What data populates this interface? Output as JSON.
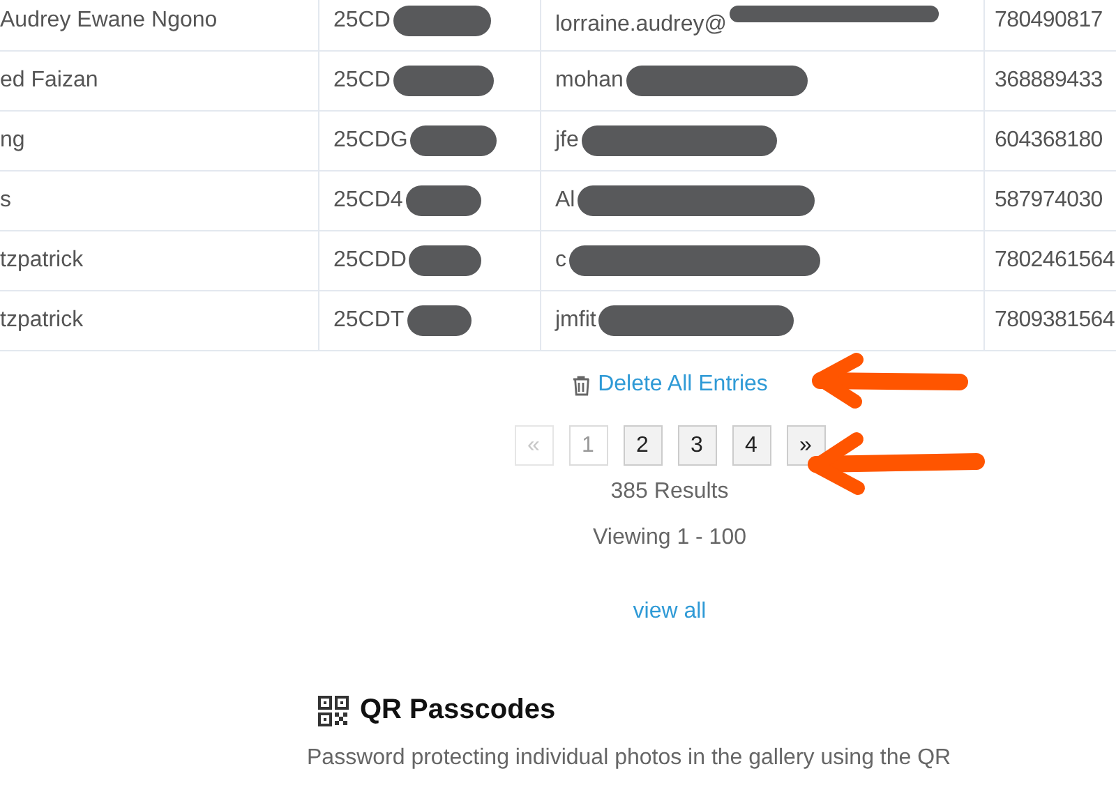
{
  "table": {
    "rows": [
      {
        "column_1": "Audrey Ewane Ngono",
        "column_2": "25CD",
        "column_3": "lorraine.audrey@",
        "column_4": "780490817"
      },
      {
        "column_1": "ed Faizan",
        "column_2": "25CD",
        "column_3": "mohan",
        "column_4": "368889433"
      },
      {
        "column_1": "ng",
        "column_2": "25CDG",
        "column_3": "jfe",
        "column_4": "604368180"
      },
      {
        "column_1": "s",
        "column_2": "25CD4",
        "column_3": "Al",
        "column_4": "587974030"
      },
      {
        "column_1": "tzpatrick",
        "column_2": "25CDD",
        "column_3": "c",
        "column_4": "7802461564"
      },
      {
        "column_1": "tzpatrick",
        "column_2": "25CDT",
        "column_3": "jmfit",
        "column_4": "7809381564"
      }
    ]
  },
  "delete_link": {
    "label": "Delete All Entries"
  },
  "pagination": [
    {
      "label": "«",
      "disabled": true,
      "selected": false
    },
    {
      "label": "1",
      "disabled": false,
      "selected": true
    },
    {
      "label": "2",
      "disabled": false,
      "selected": false
    },
    {
      "label": "3",
      "disabled": false,
      "selected": false
    },
    {
      "label": "4",
      "disabled": false,
      "selected": false
    },
    {
      "label": "»",
      "disabled": false,
      "selected": false
    }
  ],
  "results": "385 Results",
  "viewing": "Viewing 1 - 100",
  "view_all": "view all",
  "qr_section": {
    "title": "QR Passcodes",
    "text": "Password protecting individual photos in the gallery using the QR"
  }
}
